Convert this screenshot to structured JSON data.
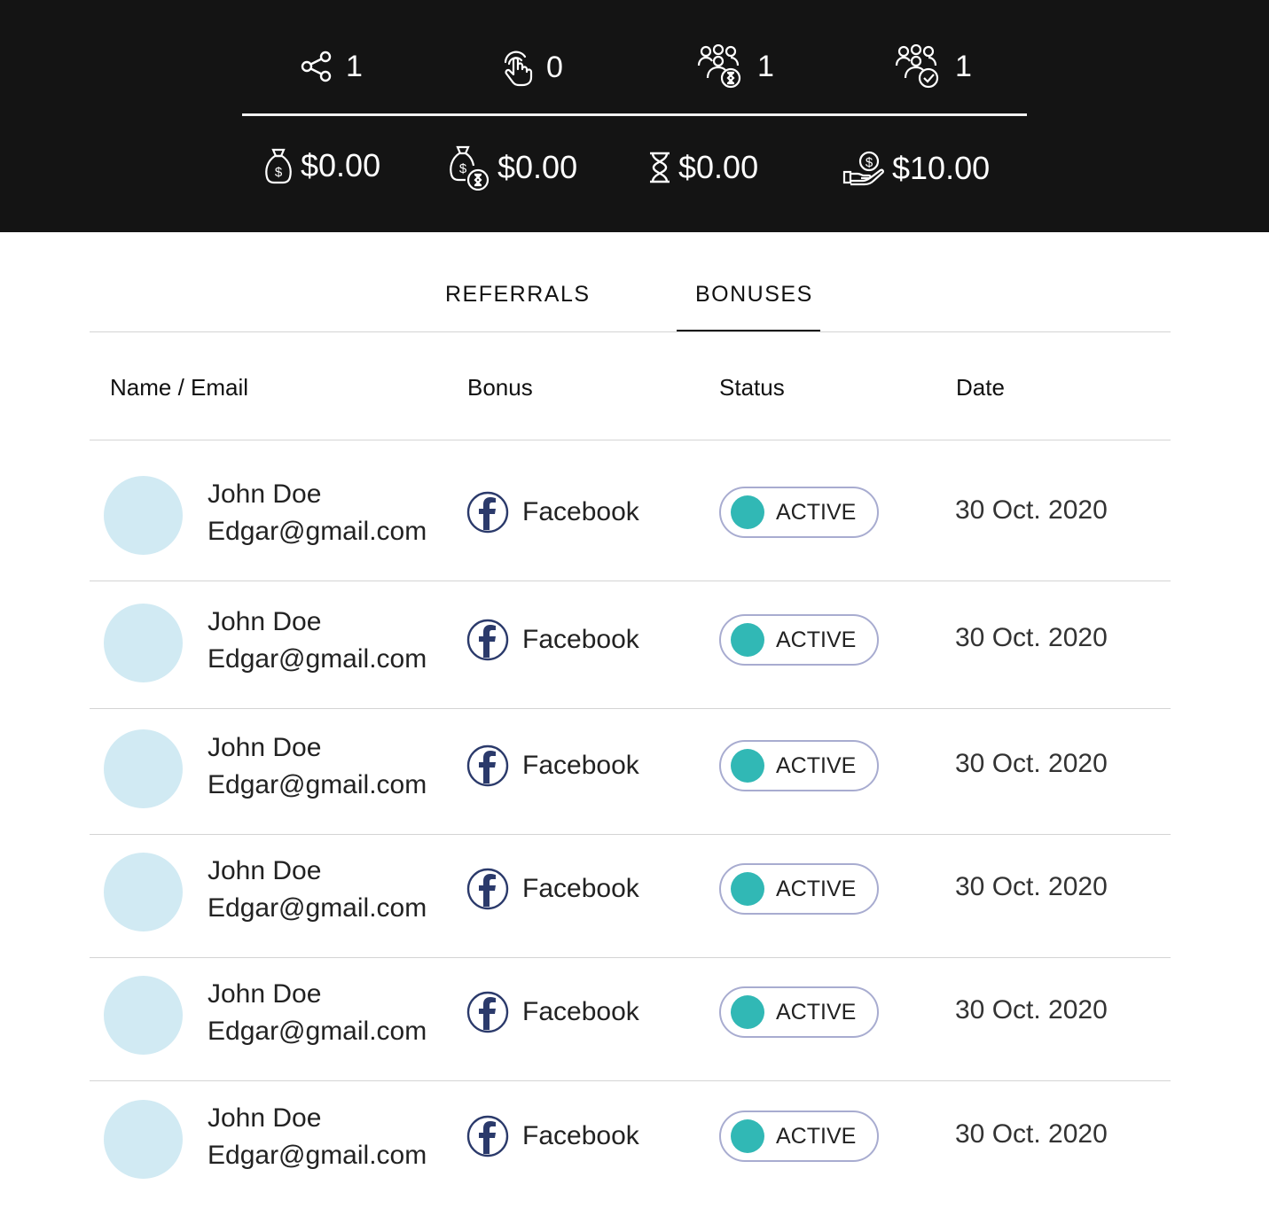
{
  "stats": {
    "top": [
      {
        "icon": "share-icon",
        "value": "1"
      },
      {
        "icon": "click-hand-icon",
        "value": "0"
      },
      {
        "icon": "group-pending-icon",
        "value": "1"
      },
      {
        "icon": "group-approved-icon",
        "value": "1"
      }
    ],
    "bottom": [
      {
        "icon": "money-bag-icon",
        "value": "$0.00"
      },
      {
        "icon": "money-bag-pending-icon",
        "value": "$0.00"
      },
      {
        "icon": "hourglass-icon",
        "value": "$0.00"
      },
      {
        "icon": "hand-coin-icon",
        "value": "$10.00"
      }
    ]
  },
  "tabs": [
    {
      "label": "REFERRALS",
      "active": false
    },
    {
      "label": "BONUSES",
      "active": true
    }
  ],
  "table": {
    "columns": [
      "Name / Email",
      "Bonus",
      "Status",
      "Date"
    ],
    "rows": [
      {
        "name": "John Doe",
        "email": "Edgar@gmail.com",
        "bonus": "Facebook",
        "status": "ACTIVE",
        "date": "30 Oct. 2020"
      },
      {
        "name": "John Doe",
        "email": "Edgar@gmail.com",
        "bonus": "Facebook",
        "status": "ACTIVE",
        "date": "30 Oct. 2020"
      },
      {
        "name": "John Doe",
        "email": "Edgar@gmail.com",
        "bonus": "Facebook",
        "status": "ACTIVE",
        "date": "30 Oct. 2020"
      },
      {
        "name": "John Doe",
        "email": "Edgar@gmail.com",
        "bonus": "Facebook",
        "status": "ACTIVE",
        "date": "30 Oct. 2020"
      },
      {
        "name": "John Doe",
        "email": "Edgar@gmail.com",
        "bonus": "Facebook",
        "status": "ACTIVE",
        "date": "30 Oct. 2020"
      },
      {
        "name": "John Doe",
        "email": "Edgar@gmail.com",
        "bonus": "Facebook",
        "status": "ACTIVE",
        "date": "30 Oct. 2020"
      }
    ]
  },
  "colors": {
    "header_bg": "#141414",
    "avatar": "#d1eaf3",
    "status_dot": "#31b8b5",
    "status_border": "#a8acd0",
    "facebook_icon": "#2b3a6b"
  }
}
